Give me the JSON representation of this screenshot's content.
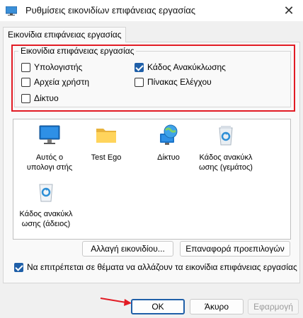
{
  "window": {
    "title": "Ρυθμίσεις εικονιδίων επιφάνειας εργασίας",
    "close_label": "✕"
  },
  "tab": {
    "label": "Εικονίδια επιφάνειας εργασίας"
  },
  "group": {
    "legend": "Εικονίδια επιφάνειας εργασίας",
    "checkboxes": [
      {
        "label": "Υπολογιστής",
        "checked": false
      },
      {
        "label": "Κάδος Ανακύκλωσης",
        "checked": true
      },
      {
        "label": "Αρχεία χρήστη",
        "checked": false
      },
      {
        "label": "Πίνακας Ελέγχου",
        "checked": false
      },
      {
        "label": "Δίκτυο",
        "checked": false
      }
    ]
  },
  "icons": [
    {
      "label": "Αυτός ο υπολογι στής",
      "icon": "monitor-icon"
    },
    {
      "label": "Test Ego",
      "icon": "folder-icon"
    },
    {
      "label": "Δίκτυο",
      "icon": "network-icon"
    },
    {
      "label": "Κάδος ανακύκλ ωσης (γεμάτος)",
      "icon": "recycle-bin-full-icon"
    },
    {
      "label": "Κάδος ανακύκλ ωσης (άδειος)",
      "icon": "recycle-bin-empty-icon"
    }
  ],
  "buttons": {
    "change_icon": "Αλλαγή εικονιδίου...",
    "restore_default": "Επαναφορά προεπιλογών",
    "ok": "OK",
    "cancel": "Άκυρο",
    "apply": "Εφαρμογή"
  },
  "theme_checkbox": {
    "label": "Να επιτρέπεται σε θέματα να αλλάζουν τα εικονίδια επιφάνειας εργασίας",
    "checked": true
  },
  "colors": {
    "accent": "#1f5fa8",
    "highlight_box": "#e21b24",
    "arrow": "#e21b24"
  }
}
